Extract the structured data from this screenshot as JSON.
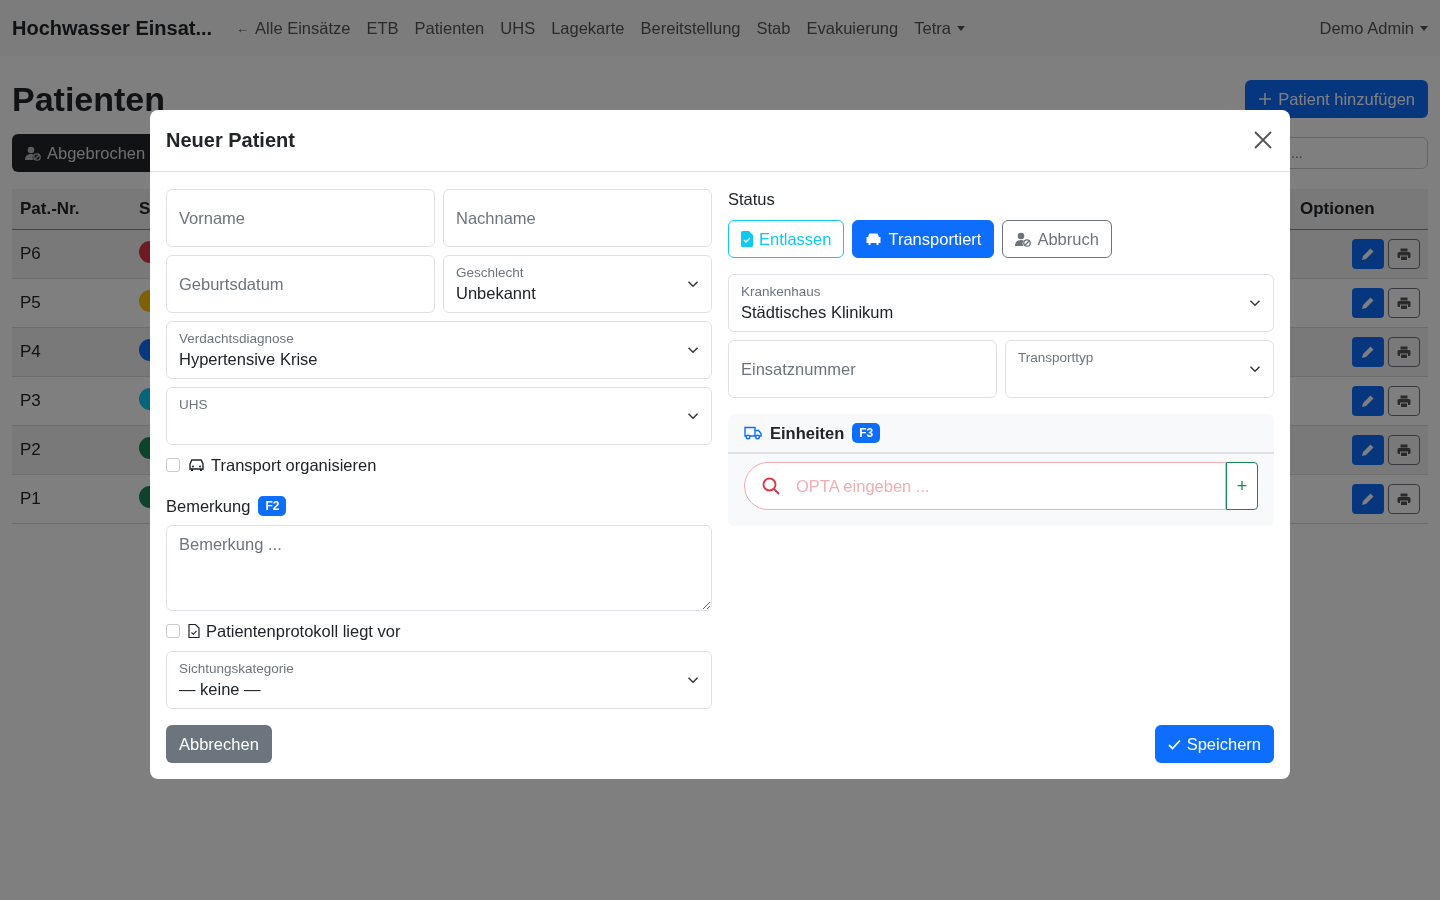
{
  "navbar": {
    "brand": "Hochwasser Einsat...",
    "back_link": {
      "arrow": "←",
      "label": "Alle Einsätze"
    },
    "links": [
      "ETB",
      "Patienten",
      "UHS",
      "Lagekarte",
      "Bereitstellung",
      "Stab",
      "Evakuierung"
    ],
    "dropdown": "Tetra",
    "user_menu": "Demo Admin"
  },
  "page": {
    "title": "Patienten",
    "add_button": "Patient hinzufügen",
    "filter_button": "Abgebrochen",
    "search": {
      "placeholder": "..."
    }
  },
  "table": {
    "columns": [
      "Pat.-Nr.",
      "S",
      "Optionen"
    ],
    "rows": [
      {
        "number": "P6",
        "color": "#6e1a22"
      },
      {
        "number": "P5",
        "color": "#806004"
      },
      {
        "number": "P4",
        "color": "#06377f"
      },
      {
        "number": "P3",
        "color": "#066578"
      },
      {
        "number": "P2",
        "color": "#0c432a"
      },
      {
        "number": "P1",
        "color": "#0c432a"
      }
    ]
  },
  "dialog": {
    "title": "Neuer Patient",
    "left": [
      {
        "kind": "pair",
        "items": [
          {
            "kind": "input",
            "placeholder": "Vorname"
          },
          {
            "kind": "input",
            "placeholder": "Nachname"
          }
        ]
      },
      {
        "kind": "pair",
        "items": [
          {
            "kind": "input",
            "placeholder": "Geburtsdatum"
          },
          {
            "kind": "select",
            "label": "Geschlecht",
            "value": "Unbekannt"
          }
        ]
      },
      {
        "kind": "select",
        "label": "Verdachtsdiagnose",
        "value": "Hypertensive Krise"
      },
      {
        "kind": "select",
        "label": "UHS"
      },
      {
        "kind": "checkbox",
        "label": "Transport organisieren",
        "checked": false
      },
      {
        "kind": "heading",
        "label": "Bemerkung",
        "badge": "F2"
      },
      {
        "kind": "textarea",
        "placeholder": "Bemerkung ..."
      },
      {
        "kind": "checkbox",
        "label": "Patientenprotokoll liegt vor",
        "checked": false
      },
      {
        "kind": "select",
        "label": "Sichtungskategorie",
        "value": "— keine —"
      }
    ],
    "status": {
      "label": "Status",
      "options": [
        {
          "label": "Entlassen",
          "color": "#0dcaf0",
          "selected": false
        },
        {
          "label": "Transportiert",
          "color": "#0d6efd",
          "selected": true
        },
        {
          "label": "Abbruch",
          "color": "#6c757d",
          "selected": false
        }
      ]
    },
    "right": [
      {
        "kind": "select",
        "label": "Krankenhaus",
        "value": "Städtisches Klinikum"
      },
      {
        "kind": "pair",
        "items": [
          {
            "kind": "input",
            "placeholder": "Einsatznummer"
          },
          {
            "kind": "select",
            "label": "Transporttyp"
          }
        ]
      }
    ],
    "units": {
      "title": "Einheiten",
      "badge": "F3",
      "search": {
        "placeholder": "OPTA eingeben ...",
        "invalid": true
      },
      "add_button": "+"
    },
    "footer": {
      "cancel": "Abbrechen",
      "save": "Speichern"
    }
  }
}
